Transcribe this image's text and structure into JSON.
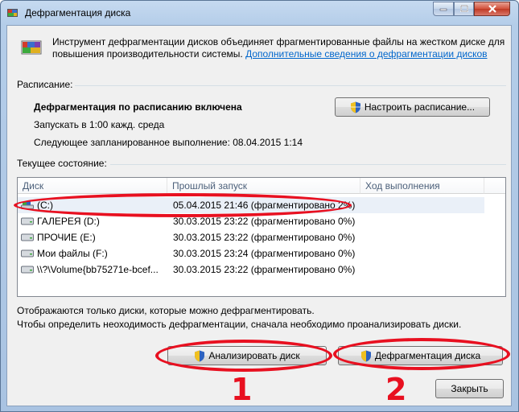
{
  "window": {
    "title": "Дефрагментация диска",
    "controls": {
      "minimize": "–",
      "maximize": "□",
      "close": "✕"
    }
  },
  "intro": {
    "text": "Инструмент дефрагментации дисков объединяет фрагментированные файлы на жестком диске для повышения производительности системы.",
    "link": "Дополнительные сведения о дефрагментации дисков"
  },
  "schedule": {
    "group_label": "Расписание:",
    "status": "Дефрагментация по расписанию включена",
    "run_at": "Запускать в 1:00 кажд. среда",
    "next_run": "Следующее запланированное выполнение: 08.04.2015 1:14",
    "configure_button": "Настроить расписание..."
  },
  "current_state": {
    "group_label": "Текущее состояние:",
    "columns": [
      "Диск",
      "Прошлый запуск",
      "Ход выполнения"
    ],
    "rows": [
      {
        "disk": "(C:)",
        "last_run": "05.04.2015 21:46 (фрагментировано 2%)",
        "progress": "",
        "icon": "system-drive-icon",
        "selected": true
      },
      {
        "disk": "ГАЛЕРЕЯ (D:)",
        "last_run": "30.03.2015 23:22 (фрагментировано 0%)",
        "progress": "",
        "icon": "drive-icon"
      },
      {
        "disk": "ПРОЧИЕ (E:)",
        "last_run": "30.03.2015 23:22 (фрагментировано 0%)",
        "progress": "",
        "icon": "drive-icon"
      },
      {
        "disk": "Мои файлы (F:)",
        "last_run": "30.03.2015 23:24 (фрагментировано 0%)",
        "progress": "",
        "icon": "drive-icon"
      },
      {
        "disk": "\\\\?\\Volume{bb75271e-bcef...",
        "last_run": "30.03.2015 23:22 (фрагментировано 0%)",
        "progress": "",
        "icon": "drive-icon"
      }
    ]
  },
  "notes": {
    "line1": "Отображаются только диски, которые можно дефрагментировать.",
    "line2": "Чтобы определить неоходимость  дефрагментации, сначала необходимо проанализировать диски."
  },
  "buttons": {
    "analyze": "Анализировать диск",
    "defrag": "Дефрагментация диска",
    "close": "Закрыть"
  },
  "annotations": {
    "num1": "1",
    "num2": "2",
    "color": "#e81020"
  }
}
